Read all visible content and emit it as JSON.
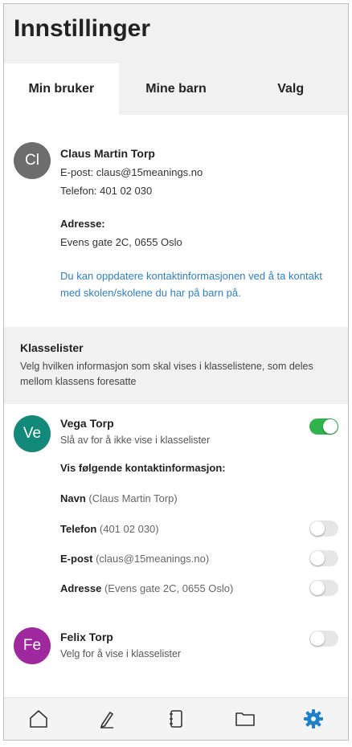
{
  "header": {
    "title": "Innstillinger"
  },
  "tabs": [
    {
      "label": "Min bruker",
      "active": true
    },
    {
      "label": "Mine barn",
      "active": false
    },
    {
      "label": "Valg",
      "active": false
    }
  ],
  "profile": {
    "initials": "Cl",
    "name": "Claus Martin Torp",
    "email_line": "E-post: claus@15meanings.no",
    "phone_line": "Telefon: 401 02 030",
    "address_label": "Adresse:",
    "address": "Evens gate 2C, 0655 Oslo",
    "info_text": "Du kan oppdatere kontaktinformasjonen ved å ta kontakt med skolen/skolene du har på barn på."
  },
  "klasselister": {
    "title": "Klasselister",
    "description": "Velg hvilken informasjon som skal vises i klasselistene, som deles mellom klassens foresatte"
  },
  "children": [
    {
      "initials": "Ve",
      "avatar_color": "#13897a",
      "name": "Vega Torp",
      "subtitle": "Slå av for å ikke vise i klasselister",
      "visible_on": true,
      "contact_title": "Vis følgende kontaktinformasjon:",
      "fields": [
        {
          "label": "Navn",
          "value": "(Claus Martin Torp)",
          "has_toggle": false
        },
        {
          "label": "Telefon",
          "value": "(401 02 030)",
          "has_toggle": true,
          "on": false
        },
        {
          "label": "E-post",
          "value": "(claus@15meanings.no)",
          "has_toggle": true,
          "on": false
        },
        {
          "label": "Adresse",
          "value": "(Evens gate 2C, 0655 Oslo)",
          "has_toggle": true,
          "on": false
        }
      ]
    },
    {
      "initials": "Fe",
      "avatar_color": "#a0289f",
      "name": "Felix Torp",
      "subtitle": "Velg for å vise i klasselister",
      "visible_on": false
    }
  ],
  "bottom_nav": [
    {
      "icon": "home-icon",
      "active": false
    },
    {
      "icon": "pencil-icon",
      "active": false
    },
    {
      "icon": "notebook-icon",
      "active": false
    },
    {
      "icon": "folder-icon",
      "active": false
    },
    {
      "icon": "settings-gear-icon",
      "active": true
    }
  ],
  "colors": {
    "accent_blue": "#2f7fc4",
    "toggle_on": "#2fb34d",
    "header_bg": "#f1f1f1",
    "active_nav": "#1f82c8"
  }
}
